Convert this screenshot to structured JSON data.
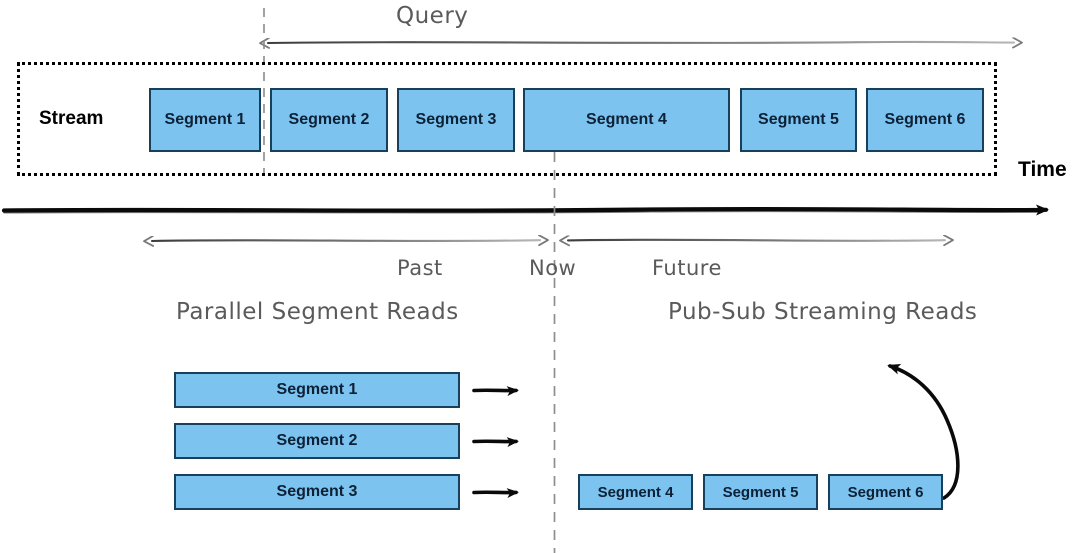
{
  "diagram": {
    "title_implicit": "Stream segment query timeline",
    "colors": {
      "segment_fill": "#7cc3f0",
      "segment_border": "#16405c",
      "hand_text": "#5a5a5a",
      "axis": "#000000",
      "background": "#ffffff"
    }
  },
  "top": {
    "query_label": "Query",
    "stream_label": "Stream",
    "time_label": "Time",
    "segments": [
      {
        "label": "Segment 1"
      },
      {
        "label": "Segment 2"
      },
      {
        "label": "Segment 3"
      },
      {
        "label": "Segment 4"
      },
      {
        "label": "Segment 5"
      },
      {
        "label": "Segment 6"
      }
    ]
  },
  "timeline": {
    "past_label": "Past",
    "now_label": "Now",
    "future_label": "Future"
  },
  "bottom": {
    "left_heading": "Parallel Segment Reads",
    "right_heading": "Pub-Sub Streaming Reads",
    "left_segments": [
      {
        "label": "Segment 1"
      },
      {
        "label": "Segment 2"
      },
      {
        "label": "Segment 3"
      }
    ],
    "right_segments": [
      {
        "label": "Segment 4"
      },
      {
        "label": "Segment 5"
      },
      {
        "label": "Segment 6"
      }
    ]
  },
  "icons": {
    "query_arrow": "double-arrow-left-right-icon",
    "time_arrow": "arrow-right-icon",
    "past_arrow": "double-arrow-icon",
    "future_arrow": "double-arrow-icon",
    "read_arrow": "arrow-right-icon",
    "loop_arrow": "curved-arrow-up-icon",
    "now_divider": "vertical-dashed-line-icon"
  }
}
